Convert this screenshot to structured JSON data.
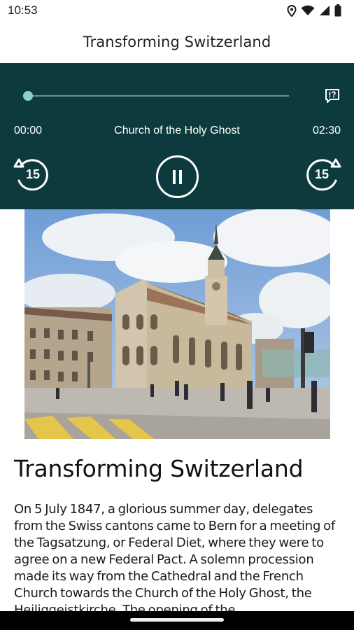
{
  "status_bar": {
    "time": "10:53",
    "icons": [
      "location-icon",
      "wifi-icon",
      "signal-icon",
      "battery-icon"
    ]
  },
  "app_bar": {
    "title": "Transforming Switzerland"
  },
  "player": {
    "current_time": "00:00",
    "track_title": "Church of the Holy Ghost",
    "total_time": "02:30",
    "progress": 0,
    "rewind_seconds": "15",
    "forward_seconds": "15",
    "state": "playing",
    "accent_color": "#8fd0c6",
    "background_color": "#0d3b3d",
    "icons": [
      "transcript-icon",
      "rewind-15-icon",
      "pause-icon",
      "forward-15-icon"
    ]
  },
  "article": {
    "title": "Transforming Switzerland",
    "body": "On 5 July 1847, a glorious summer day, delegates from the Swiss cantons came to Bern for a meeting of the Tagsatzung, or Federal Diet, where they were to agree on a new Federal Pact. A solemn procession made its way from the Cathedral and the French Church towards the Church of the Holy Ghost, the Heiliggeistkirche. The opening of the"
  }
}
